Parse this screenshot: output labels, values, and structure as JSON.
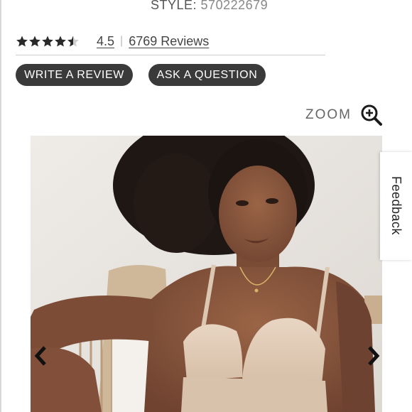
{
  "product": {
    "style_label": "STYLE:",
    "style_number": "570222679"
  },
  "rating": {
    "stars": 4.5,
    "average": "4.5",
    "separator": "|",
    "reviews_label": "6769 Reviews"
  },
  "actions": {
    "write_review": "WRITE A REVIEW",
    "ask_question": "ASK A QUESTION"
  },
  "zoom": {
    "label": "ZOOM",
    "icon": "zoom-in-icon"
  },
  "feedback": {
    "label": "Feedback"
  },
  "gallery": {
    "prev_icon": "chevron-left-icon",
    "next_icon": "chevron-right-icon"
  },
  "colors": {
    "button_bg": "#3a3a3a",
    "button_text": "#ffffff",
    "text_muted": "#888888"
  }
}
